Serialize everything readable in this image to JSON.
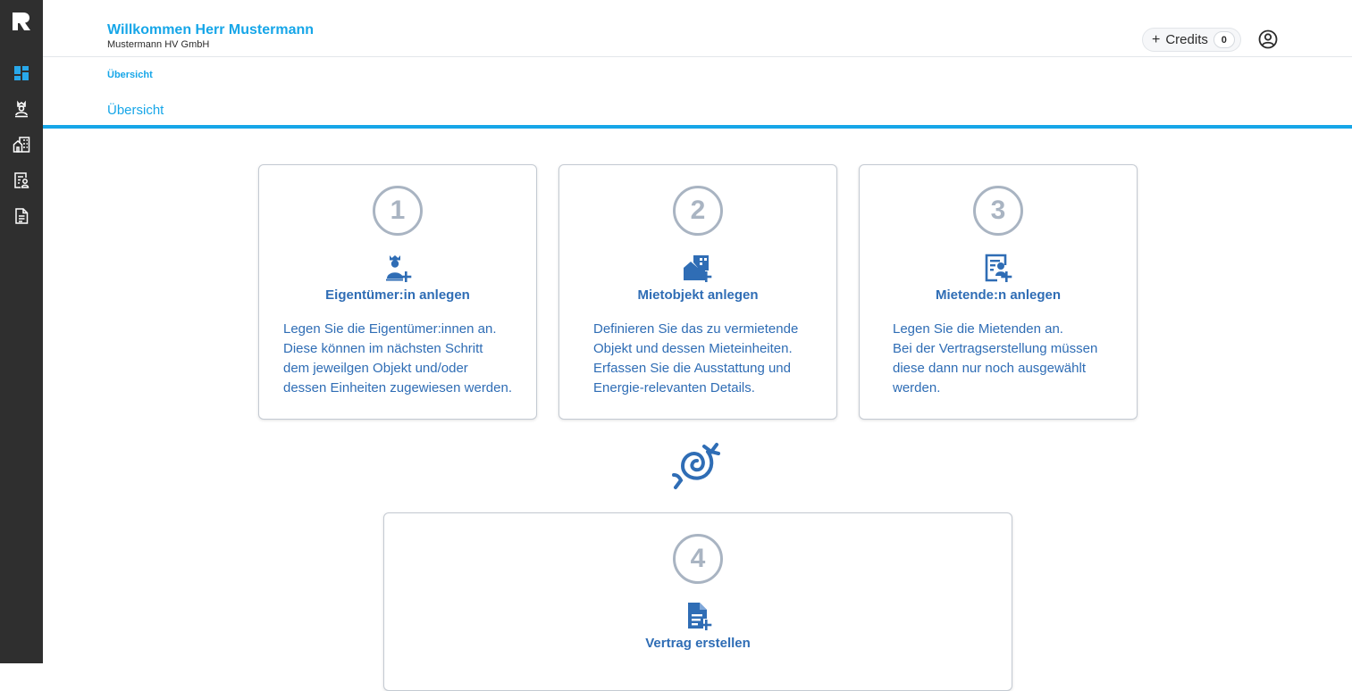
{
  "header": {
    "welcome": "Willkommen Herr Mustermann",
    "company": "Mustermann HV GmbH",
    "credits_label": "Credits",
    "credits_count": "0"
  },
  "breadcrumb": "Übersicht",
  "tab": "Übersicht",
  "sidebar": {
    "items": [
      {
        "icon": "dashboard-icon"
      },
      {
        "icon": "owner-icon"
      },
      {
        "icon": "buildings-icon"
      },
      {
        "icon": "tenant-list-icon"
      },
      {
        "icon": "document-icon"
      }
    ]
  },
  "colors": {
    "accent": "#16a6e8",
    "card_text": "#2f6db5",
    "number_ring": "#a9b4c2",
    "sidebar": "#2f2f2f"
  },
  "steps": [
    {
      "number": "1",
      "title": "Eigentümer:in anlegen",
      "icon": "add-owner-icon",
      "lines": [
        "Legen Sie die Eigentümer:innen an.",
        "Diese können im nächsten Schritt",
        "dem jeweilgen Objekt und/oder",
        "dessen Einheiten zugewiesen werden."
      ]
    },
    {
      "number": "2",
      "title": "Mietobjekt anlegen",
      "icon": "add-property-icon",
      "lines": [
        "Definieren Sie das zu vermietende",
        "Objekt und dessen Mieteinheiten.",
        "Erfassen Sie die Ausstattung und",
        "Energie-relevanten Details."
      ]
    },
    {
      "number": "3",
      "title": "Mietende:n anlegen",
      "icon": "add-tenant-icon",
      "lines": [
        "Legen Sie die Mietenden an.",
        "Bei der Vertragserstellung müssen",
        "diese dann nur noch ausgewählt",
        "werden."
      ]
    },
    {
      "number": "4",
      "title": "Vertrag erstellen",
      "icon": "create-contract-icon"
    }
  ]
}
